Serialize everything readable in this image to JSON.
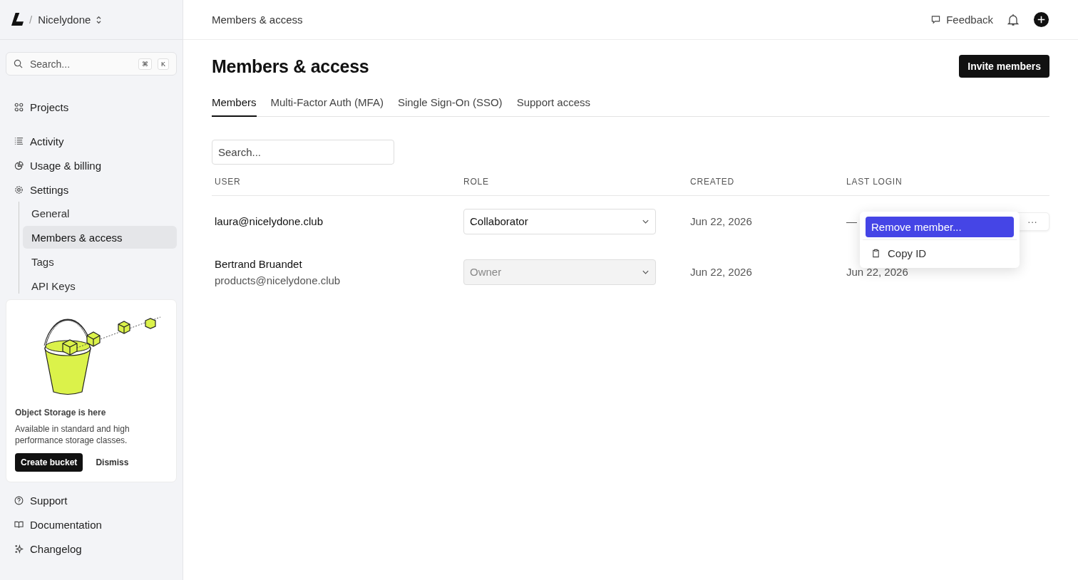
{
  "workspace": {
    "separator": "/",
    "name": "Nicelydone"
  },
  "sidebar": {
    "search": {
      "placeholder": "Search...",
      "keys": [
        "⌘",
        "K"
      ]
    },
    "groups": [
      [
        {
          "label": "Projects",
          "selected": false
        }
      ],
      [
        {
          "label": "Activity",
          "selected": false
        },
        {
          "label": "Usage & billing",
          "selected": false
        },
        {
          "label": "Settings",
          "selected": false,
          "children": [
            {
              "label": "General",
              "selected": false
            },
            {
              "label": "Members & access",
              "selected": true
            },
            {
              "label": "Tags",
              "selected": false
            },
            {
              "label": "API Keys",
              "selected": false
            }
          ]
        }
      ]
    ],
    "promo": {
      "title": "Object Storage is here",
      "text": "Available in standard and high performance storage classes.",
      "primary": "Create bucket",
      "secondary": "Dismiss"
    },
    "footer": [
      {
        "label": "Support"
      },
      {
        "label": "Documentation"
      },
      {
        "label": "Changelog"
      }
    ]
  },
  "topbar": {
    "breadcrumb": "Members & access",
    "feedback": "Feedback"
  },
  "page": {
    "title": "Members & access",
    "action": "Invite members"
  },
  "tabs": [
    {
      "label": "Members",
      "selected": true
    },
    {
      "label": "Multi-Factor Auth (MFA)",
      "selected": false
    },
    {
      "label": "Single Sign-On (SSO)",
      "selected": false
    },
    {
      "label": "Support access",
      "selected": false
    }
  ],
  "search": {
    "placeholder": "Search..."
  },
  "table": {
    "columns": [
      "USER",
      "ROLE",
      "CREATED",
      "LAST LOGIN"
    ],
    "rows": [
      {
        "name": "laura@nicelydone.club",
        "role": "Collaborator",
        "role_disabled": false,
        "created": "Jun 22, 2026",
        "last_login": "—",
        "actions": "···"
      },
      {
        "name": "Bertrand Bruandet",
        "email": "products@nicelydone.club",
        "role": "Owner",
        "role_disabled": true,
        "created": "Jun 22, 2026",
        "last_login": "Jun 22, 2026"
      }
    ]
  },
  "menu": {
    "items": [
      {
        "label": "Remove member...",
        "selected": true,
        "kind": "plain"
      },
      {
        "label": "Copy ID",
        "selected": false,
        "kind": "icon"
      }
    ]
  }
}
